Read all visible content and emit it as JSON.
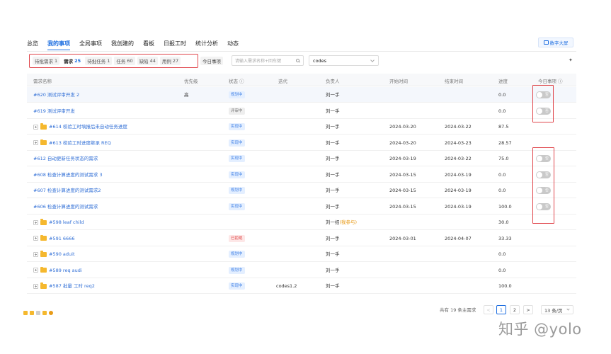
{
  "nav": {
    "items": [
      "总览",
      "我的事项",
      "全局事项",
      "我创建的",
      "看板",
      "日报工时",
      "统计分析",
      "动态"
    ],
    "active_index": 1,
    "dashboard_button": "数字大屏"
  },
  "filters": {
    "chips": [
      {
        "label": "待批需求",
        "count": "1"
      },
      {
        "label": "需求",
        "count": "25"
      },
      {
        "label": "待批任务",
        "count": "1"
      },
      {
        "label": "任务",
        "count": "60"
      },
      {
        "label": "缺陷",
        "count": "44"
      },
      {
        "label": "用例",
        "count": "27"
      }
    ],
    "active_chip": 1,
    "today_label": "今日事项",
    "search_placeholder": "请输入需求名称+回车键",
    "select_value": "codes"
  },
  "table": {
    "headers": {
      "name": "需求名称",
      "priority": "优先级",
      "status": "状态 ⓘ",
      "iteration": "迭代",
      "owner": "负责人",
      "start": "开始时间",
      "end": "结束时间",
      "progress": "进度",
      "today": "今日事项 ⓘ"
    },
    "rows": [
      {
        "name": "#620 测试评审开发 2",
        "priority": "高",
        "status": "规划中",
        "status_color": "blue",
        "iteration": "",
        "owner": "刘一手",
        "owner_tag": "",
        "start": "",
        "end": "",
        "progress": "0.0",
        "toggle": "否",
        "expand": false,
        "folder": false,
        "highlight": true
      },
      {
        "name": "#619 测试评审开发",
        "priority": "",
        "status": "评审中",
        "status_color": "gray",
        "iteration": "",
        "owner": "刘一手",
        "owner_tag": "",
        "start": "",
        "end": "",
        "progress": "0.0",
        "toggle": "否",
        "expand": false,
        "folder": false,
        "highlight": false
      },
      {
        "name": "#614 校验工时填报后未自动任务进度",
        "priority": "",
        "status": "实现中",
        "status_color": "blue",
        "iteration": "",
        "owner": "刘一手",
        "owner_tag": "",
        "start": "2024-03-20",
        "end": "2024-03-22",
        "progress": "87.5",
        "toggle": "",
        "expand": true,
        "folder": true,
        "highlight": false
      },
      {
        "name": "#613 校验工时进度继承 REQ",
        "priority": "",
        "status": "实现中",
        "status_color": "blue",
        "iteration": "",
        "owner": "刘一手",
        "owner_tag": "",
        "start": "2024-03-20",
        "end": "2024-03-23",
        "progress": "28.57",
        "toggle": "",
        "expand": true,
        "folder": true,
        "highlight": false
      },
      {
        "name": "#612 自动更新任务状态的需求",
        "priority": "",
        "status": "实现中",
        "status_color": "blue",
        "iteration": "",
        "owner": "刘一手",
        "owner_tag": "",
        "start": "2024-03-19",
        "end": "2024-03-22",
        "progress": "75.0",
        "toggle": "否",
        "expand": false,
        "folder": false,
        "highlight": false
      },
      {
        "name": "#608 检查计算进度的测试需求 3",
        "priority": "",
        "status": "实现中",
        "status_color": "blue",
        "iteration": "",
        "owner": "刘一手",
        "owner_tag": "",
        "start": "2024-03-15",
        "end": "2024-03-19",
        "progress": "0.0",
        "toggle": "否",
        "expand": false,
        "folder": false,
        "highlight": false
      },
      {
        "name": "#607 检查计算进度的测试需求2",
        "priority": "",
        "status": "规划中",
        "status_color": "blue",
        "iteration": "",
        "owner": "刘一手",
        "owner_tag": "",
        "start": "2024-03-15",
        "end": "2024-03-19",
        "progress": "0.0",
        "toggle": "否",
        "expand": false,
        "folder": false,
        "highlight": false
      },
      {
        "name": "#606 检查计算进度的测试需求",
        "priority": "",
        "status": "实现中",
        "status_color": "blue",
        "iteration": "",
        "owner": "刘一手",
        "owner_tag": "",
        "start": "2024-03-15",
        "end": "2024-03-19",
        "progress": "100.0",
        "toggle": "否",
        "expand": false,
        "folder": false,
        "highlight": false
      },
      {
        "name": "#598 leaf child",
        "priority": "",
        "status": "",
        "status_color": "",
        "iteration": "",
        "owner": "刘一招",
        "owner_tag": "(我参与)",
        "start": "",
        "end": "",
        "progress": "30.0",
        "toggle": "",
        "expand": true,
        "folder": true,
        "highlight": false
      },
      {
        "name": "#591 6666",
        "priority": "",
        "status": "已拒绝",
        "status_color": "red",
        "iteration": "",
        "owner": "刘一手",
        "owner_tag": "",
        "start": "2024-03-01",
        "end": "2024-04-07",
        "progress": "33.33",
        "toggle": "",
        "expand": true,
        "folder": true,
        "highlight": false
      },
      {
        "name": "#590 aduit",
        "priority": "",
        "status": "规划中",
        "status_color": "blue",
        "iteration": "",
        "owner": "刘一手",
        "owner_tag": "",
        "start": "",
        "end": "",
        "progress": "0.0",
        "toggle": "",
        "expand": true,
        "folder": true,
        "highlight": false
      },
      {
        "name": "#589 req audi",
        "priority": "",
        "status": "规划中",
        "status_color": "blue",
        "iteration": "",
        "owner": "刘一手",
        "owner_tag": "",
        "start": "",
        "end": "",
        "progress": "0.0",
        "toggle": "",
        "expand": true,
        "folder": true,
        "highlight": false
      },
      {
        "name": "#587 批量 工时 req2",
        "priority": "",
        "status": "实现中",
        "status_color": "blue",
        "iteration": "codes1.2",
        "owner": "刘一手",
        "owner_tag": "",
        "start": "",
        "end": "",
        "progress": "100.0",
        "toggle": "",
        "expand": true,
        "folder": true,
        "highlight": false
      }
    ]
  },
  "pagination": {
    "total_text": "共有 19 条主需求",
    "prev": "<",
    "pages": [
      "1",
      "2"
    ],
    "current": "1",
    "next": ">",
    "page_size": "13 条/页"
  },
  "watermark": "知乎 @yolo",
  "colors": {
    "accent": "#1f6fe0",
    "highlight_box": "#e0464c",
    "folder": "#f5b82e"
  }
}
